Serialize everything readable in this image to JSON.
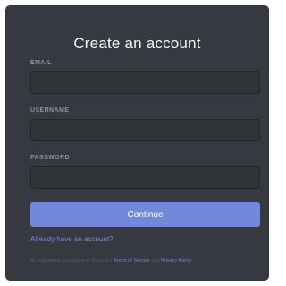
{
  "form": {
    "title": "Create an account",
    "fields": [
      {
        "label": "EMAIL",
        "value": "",
        "placeholder": ""
      },
      {
        "label": "USERNAME",
        "value": "",
        "placeholder": ""
      },
      {
        "label": "PASSWORD",
        "value": "",
        "placeholder": ""
      }
    ],
    "continue_label": "Continue",
    "login_link": "Already have an account?",
    "terms": {
      "prefix": "By registering, you agree to Discord's ",
      "tos": "Terms of Service",
      "and": " and ",
      "privacy": "Privacy Policy",
      "suffix": "."
    }
  },
  "colors": {
    "background": "#36393f",
    "accent": "#7289da",
    "input_background": "#303338",
    "label": "#8e9297"
  }
}
